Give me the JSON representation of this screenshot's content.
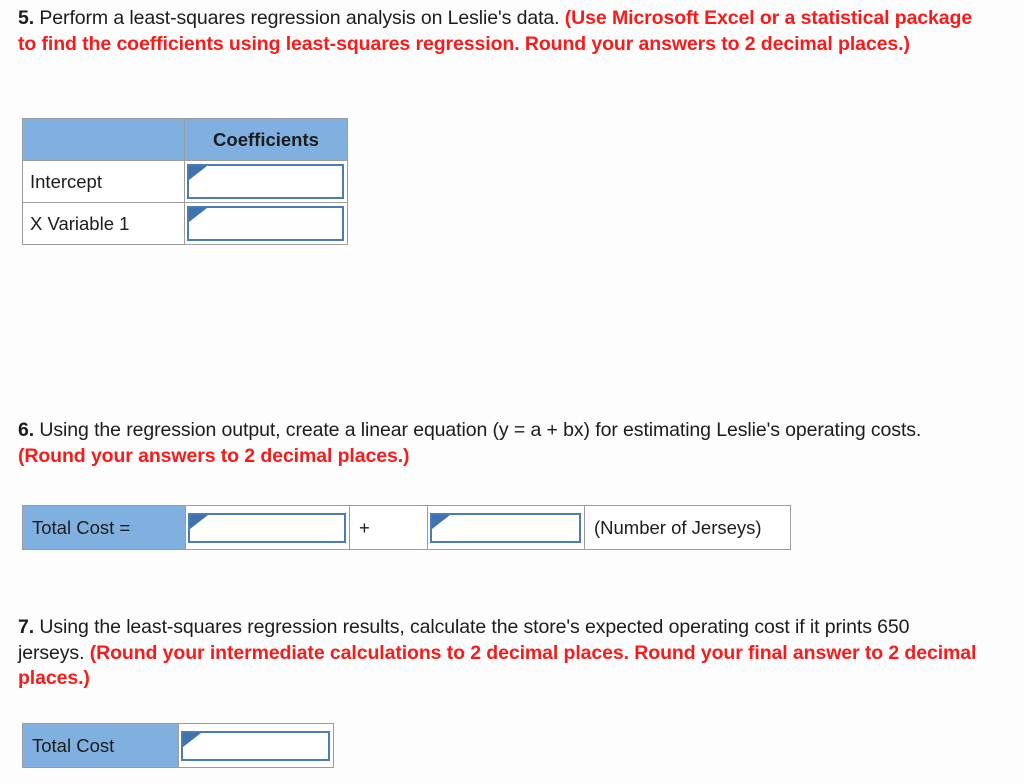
{
  "questions": [
    {
      "number": "5.",
      "text_black": " Perform a least-squares regression analysis on Leslie's data. ",
      "text_red": "(Use Microsoft Excel or a statistical package to find the coefficients using least-squares regression. Round your answers to 2 decimal places.)"
    },
    {
      "number": "6.",
      "text_black": " Using the regression output, create a linear equation (y = a + bx) for estimating Leslie's operating costs. ",
      "text_red": "(Round your answers to 2 decimal places.)"
    },
    {
      "number": "7.",
      "text_black": " Using the least-squares regression results, calculate the store's expected operating cost if it prints 650 jerseys. ",
      "text_red": "(Round your intermediate calculations to 2 decimal places. Round your final answer to 2 decimal places.)"
    }
  ],
  "coefficients_table": {
    "header_blank": "",
    "header_coefficients": "Coefficients",
    "row_intercept_label": "Intercept",
    "row_intercept_value": "",
    "row_xvariable_label": "X Variable 1",
    "row_xvariable_value": ""
  },
  "equation_table": {
    "label": "Total Cost =",
    "intercept_value": "",
    "operator": "+",
    "slope_value": "",
    "units": "(Number of Jerseys)"
  },
  "total_cost_table": {
    "label": "Total Cost",
    "value": ""
  },
  "colors": {
    "header_blue": "#7fb0e0",
    "input_border_blue": "#4b7db5",
    "marker_blue": "#3f72ae",
    "red_text": "#fb1a1a",
    "body_text": "#1c1c1c",
    "table_border": "#9c9c9c"
  }
}
